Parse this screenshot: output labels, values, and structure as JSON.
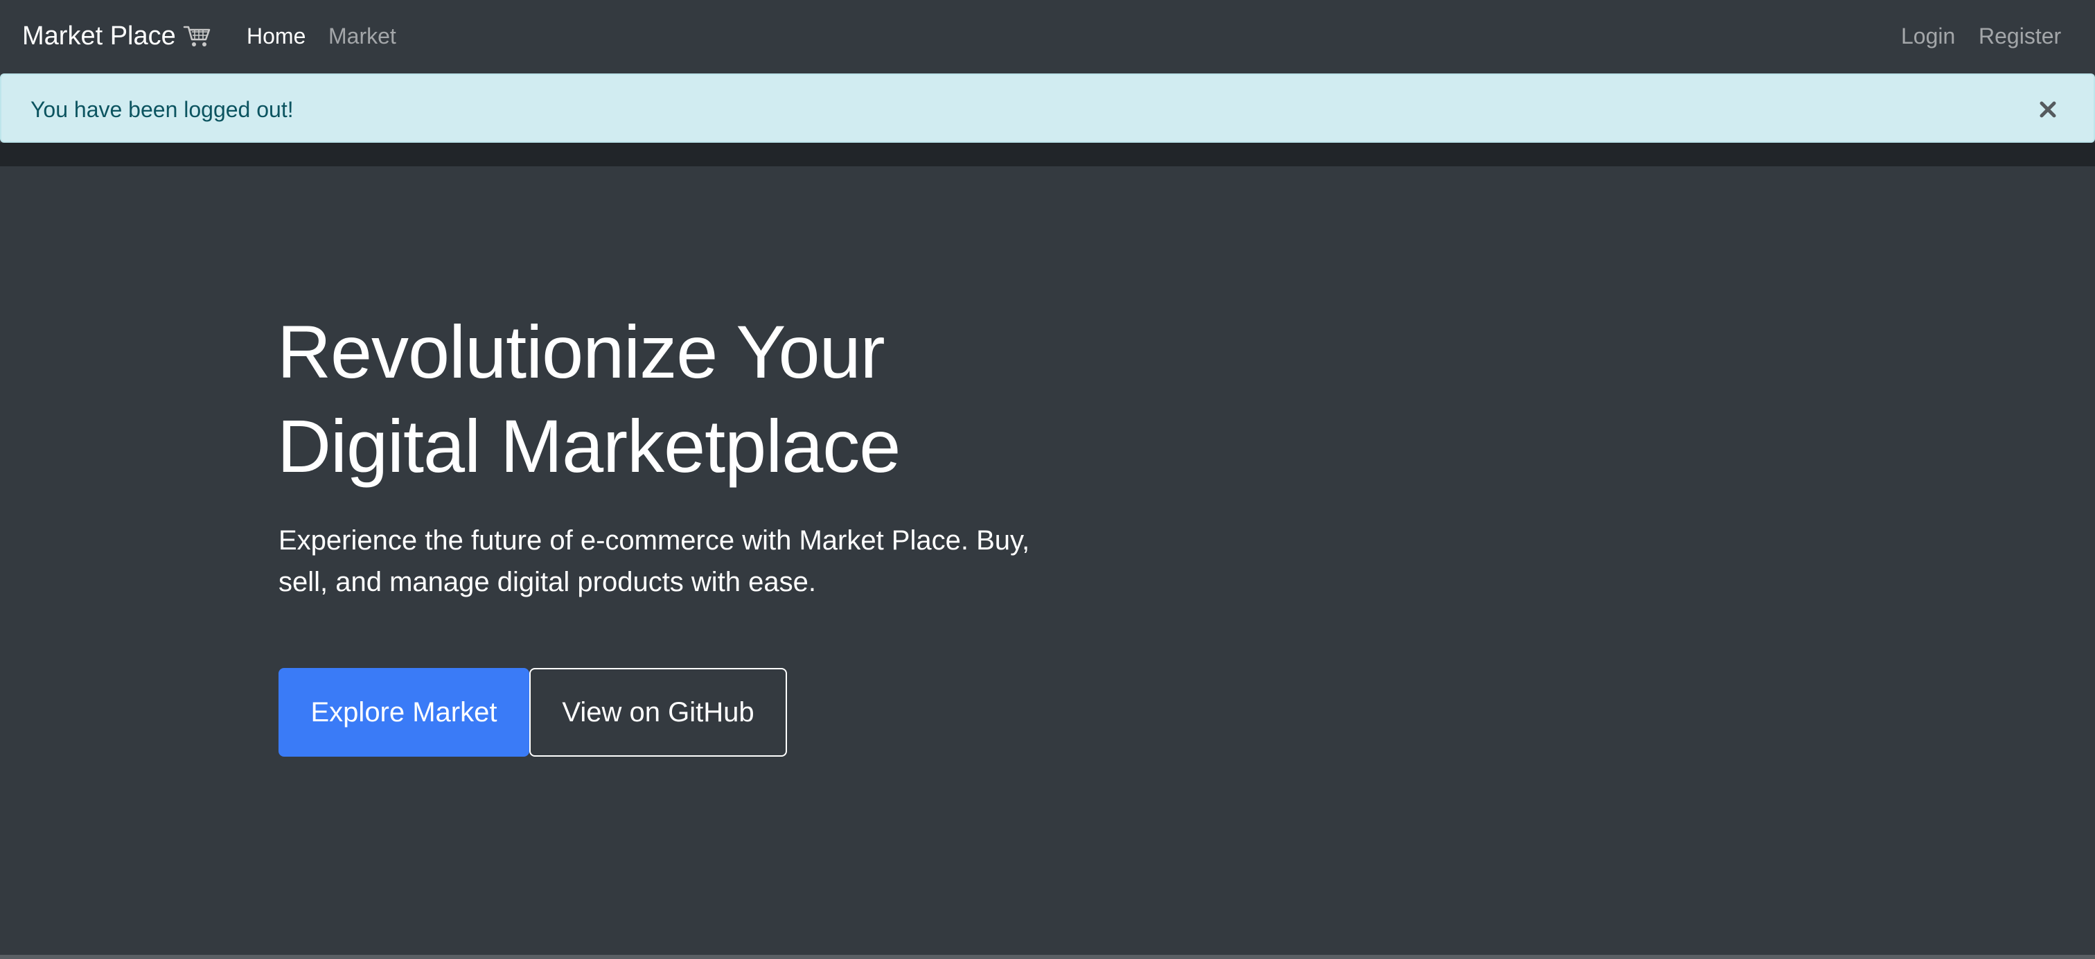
{
  "navbar": {
    "brand": "Market Place",
    "brand_icon": "shopping-cart-icon",
    "links": {
      "home": "Home",
      "market": "Market",
      "login": "Login",
      "register": "Register"
    }
  },
  "alert": {
    "message": "You have been logged out!",
    "close_icon": "close-icon"
  },
  "hero": {
    "title_line1": "Revolutionize Your",
    "title_line2": "Digital Marketplace",
    "lead": "Experience the future of e-commerce with Market Place. Buy, sell, and manage digital products with ease.",
    "primary_button": "Explore Market",
    "secondary_button": "View on GitHub"
  },
  "colors": {
    "background": "#343a40",
    "alert_bg": "#d1ecf1",
    "alert_text": "#0c5460",
    "primary": "#3a7bf7"
  }
}
